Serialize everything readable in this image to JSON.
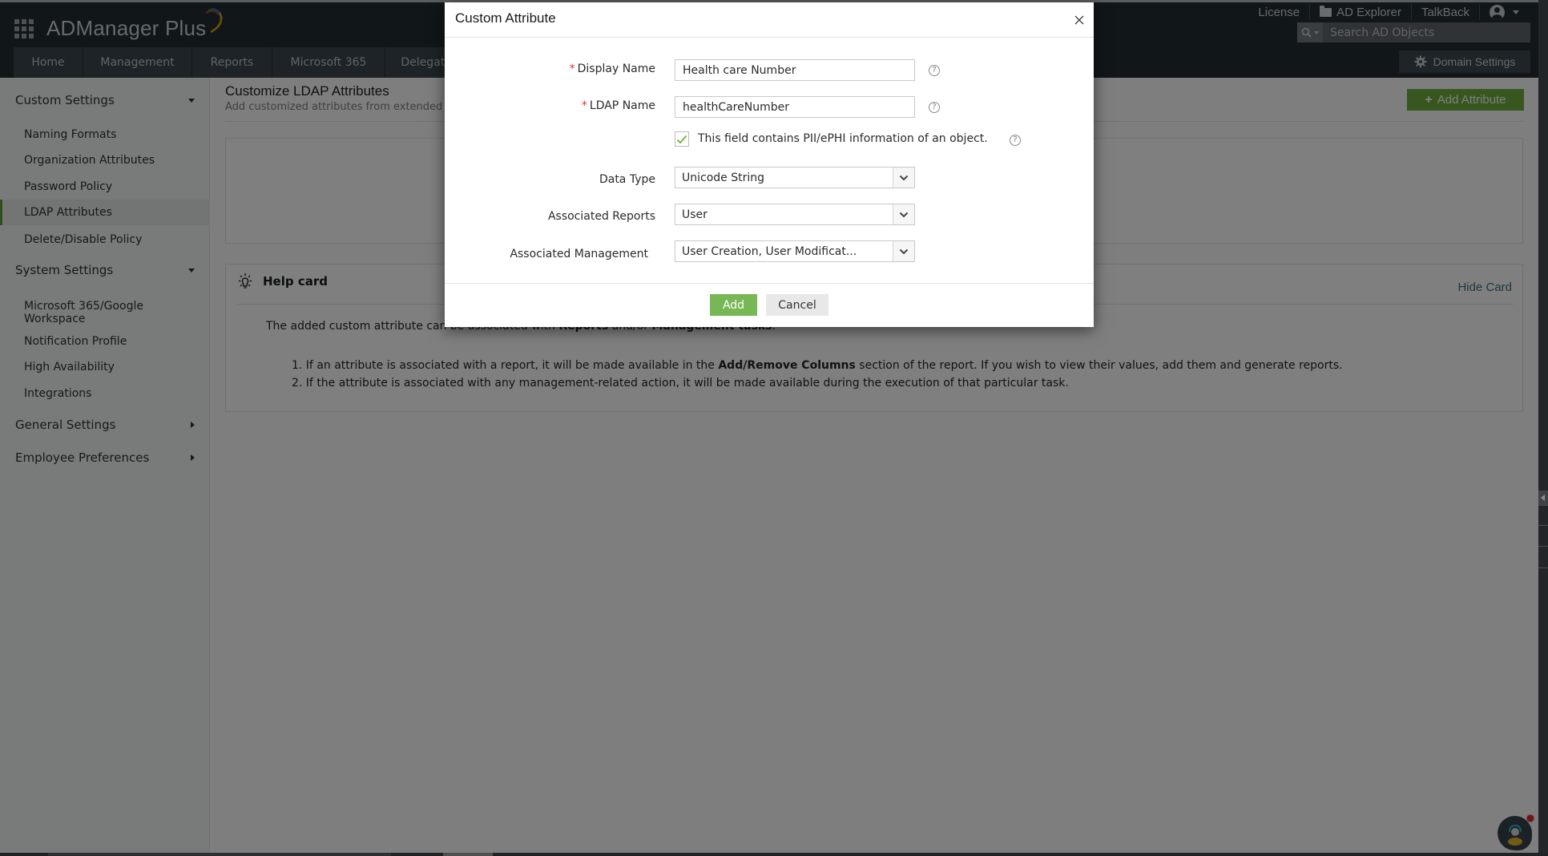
{
  "app": {
    "name": "ADManager Plus",
    "top_links": {
      "license": "License",
      "ad_explorer": "AD Explorer",
      "talkback": "TalkBack"
    },
    "search": {
      "placeholder": "Search AD Objects",
      "value": ""
    },
    "nav_tabs": [
      {
        "label": "Home"
      },
      {
        "label": "Management"
      },
      {
        "label": "Reports"
      },
      {
        "label": "Microsoft 365"
      },
      {
        "label": "Delegation"
      }
    ],
    "domain_settings_label": "Domain Settings"
  },
  "sidebar": {
    "groups": [
      {
        "label": "Custom Settings",
        "expanded": true,
        "items": [
          {
            "label": "Naming Formats"
          },
          {
            "label": "Organization Attributes"
          },
          {
            "label": "Password Policy"
          },
          {
            "label": "LDAP Attributes",
            "active": true
          },
          {
            "label": "Delete/Disable Policy"
          }
        ]
      },
      {
        "label": "System Settings",
        "expanded": true,
        "items": [
          {
            "label": "Microsoft 365/Google Workspace"
          },
          {
            "label": "Notification Profile"
          },
          {
            "label": "High Availability"
          },
          {
            "label": "Integrations"
          }
        ]
      },
      {
        "label": "General Settings",
        "expanded": false
      },
      {
        "label": "Employee Preferences",
        "expanded": false
      }
    ]
  },
  "main": {
    "title": "Customize LDAP Attributes",
    "subtitle": "Add customized attributes from extended s",
    "add_attribute_label": "Add Attribute",
    "help_card": {
      "title": "Help card",
      "hide_label": "Hide Card",
      "intro_pre": "The added custom attribute can be associated with ",
      "intro_b1": "Reports",
      "intro_mid": " and/or ",
      "intro_b2": "Management tasks",
      "intro_post": ".",
      "item1_pre": "1. If an attribute is associated with a report, it will be made available in the ",
      "item1_b": "Add/Remove Columns",
      "item1_post": " section of the report. If you wish to view their values, add them and generate reports.",
      "item2": "2. If the attribute is associated with any management-related action, it will be made available during the execution of that particular task."
    }
  },
  "dialog": {
    "title": "Custom Attribute",
    "fields": {
      "display_name": {
        "label": "Display Name",
        "required": true,
        "value": "Health care Number"
      },
      "ldap_name": {
        "label": "LDAP Name",
        "required": true,
        "value": "healthCareNumber"
      },
      "pii": {
        "label": "This field contains PII/ePHI information of an object.",
        "checked": true
      },
      "data_type": {
        "label": "Data Type",
        "value": "Unicode String"
      },
      "associated_reports": {
        "label": "Associated Reports",
        "value": "User"
      },
      "associated_management": {
        "label": "Associated Management",
        "value": "User Creation, User Modificat..."
      }
    },
    "add_label": "Add",
    "cancel_label": "Cancel",
    "required_marker": "*",
    "help_glyph": "?"
  },
  "colors": {
    "accent_green": "#77b755",
    "header_bg": "#232c31",
    "required_red": "#e0342f",
    "link_blue": "#3d6f86"
  }
}
